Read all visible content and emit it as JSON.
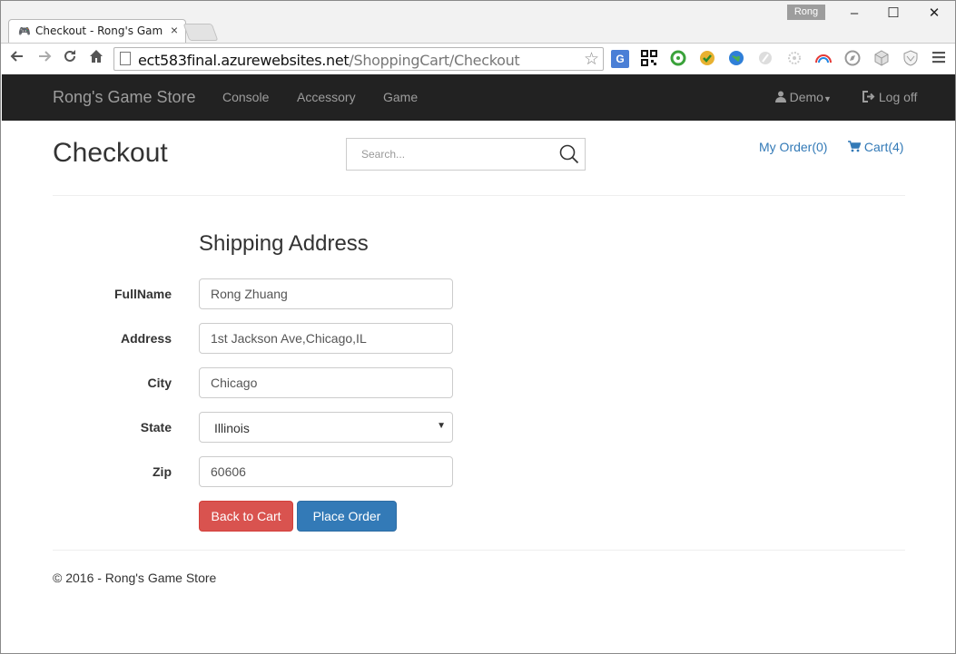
{
  "browser": {
    "tab_title": "Checkout - Rong's Game S",
    "tab_close": "×",
    "profile_name": "Rong",
    "window_controls": {
      "minimize": "–",
      "maximize": "☐",
      "close": "✕"
    },
    "url_domain": "ect583final.azurewebsites.net",
    "url_path": "/ShoppingCart/Checkout",
    "extension_icons": [
      "translate-icon",
      "qr-code-icon",
      "leaf-swirl-icon",
      "checkmark-gem-icon",
      "globe-icon",
      "feather-icon",
      "gear-flower-icon",
      "rainbow-icon",
      "compass-icon",
      "cube-icon",
      "shield-icon"
    ]
  },
  "navbar": {
    "brand": "Rong's Game Store",
    "links": [
      "Console",
      "Accessory",
      "Game"
    ],
    "user": "Demo",
    "logoff": "Log off"
  },
  "header": {
    "title": "Checkout",
    "search_placeholder": "Search...",
    "my_order": "My Order(0)",
    "cart": "Cart(4)"
  },
  "form": {
    "section_title": "Shipping Address",
    "fields": [
      {
        "label": "FullName",
        "value": "Rong Zhuang"
      },
      {
        "label": "Address",
        "value": "1st Jackson Ave,Chicago,IL"
      },
      {
        "label": "City",
        "value": "Chicago"
      },
      {
        "label": "State",
        "value": "Illinois"
      },
      {
        "label": "Zip",
        "value": "60606"
      }
    ],
    "back_button": "Back to Cart",
    "place_button": "Place Order"
  },
  "footer": {
    "text": "© 2016 - Rong's Game Store"
  },
  "colors": {
    "navbar_bg": "#222222",
    "nav_text": "#9d9d9d",
    "link": "#337ab7",
    "danger": "#d9534f",
    "primary": "#337ab7"
  }
}
